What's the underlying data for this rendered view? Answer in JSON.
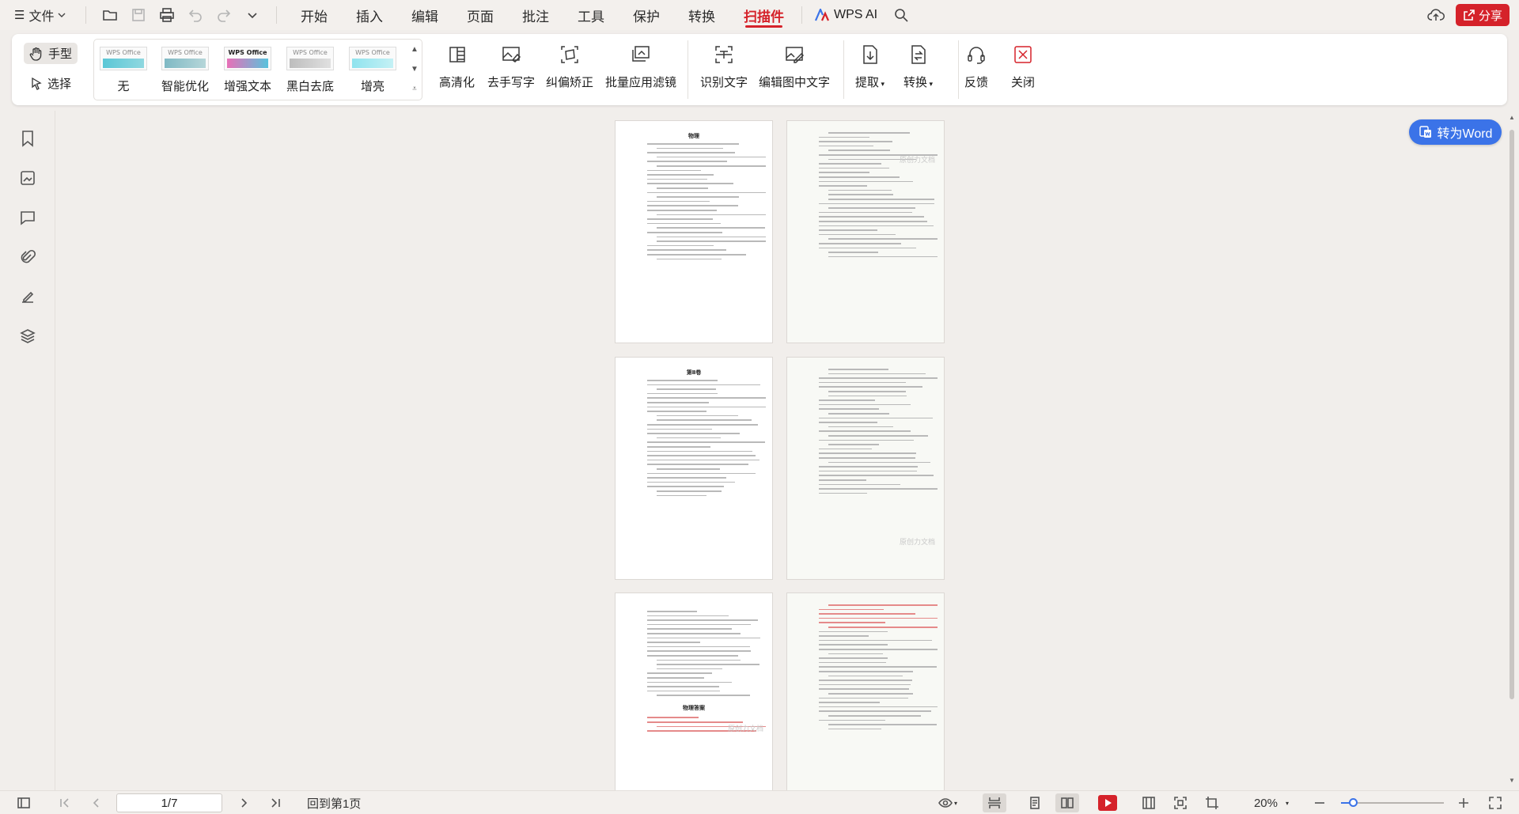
{
  "menubar": {
    "file_label": "文件",
    "tabs": [
      "开始",
      "插入",
      "编辑",
      "页面",
      "批注",
      "工具",
      "保护",
      "转换",
      "扫描件"
    ],
    "active_tab": "扫描件",
    "wps_ai": "WPS AI",
    "share": "分享"
  },
  "ribbon": {
    "hand": "手型",
    "select": "选择",
    "filters": [
      {
        "label": "无",
        "thumb": "WPS Office"
      },
      {
        "label": "智能优化",
        "thumb": "WPS Office"
      },
      {
        "label": "增强文本",
        "thumb": "WPS Office"
      },
      {
        "label": "黑白去底",
        "thumb": "WPS Office"
      },
      {
        "label": "增亮",
        "thumb": "WPS Office"
      }
    ],
    "buttons": {
      "hd": "高清化",
      "remove_handwriting": "去手写字",
      "deskew": "纠偏矫正",
      "batch_filter": "批量应用滤镜",
      "ocr": "识别文字",
      "edit_image_text": "编辑图中文字",
      "extract": "提取",
      "convert": "转换",
      "feedback": "反馈",
      "close": "关闭"
    }
  },
  "canvas": {
    "convert_to_word": "转为Word",
    "pages": [
      {
        "title": "物理",
        "accent": false
      },
      {
        "title": "",
        "accent": false
      },
      {
        "title": "第Ⅱ卷",
        "accent": false
      },
      {
        "title": "",
        "accent": false
      },
      {
        "title": "物理答案",
        "accent": true
      },
      {
        "title": "",
        "accent": true
      }
    ],
    "watermark": "原创力文档"
  },
  "statusbar": {
    "page_indicator": "1/7",
    "back_to_first": "回到第1页",
    "zoom": "20%",
    "zoom_fraction": 0.05
  },
  "colors": {
    "accent": "#d5222a",
    "primary": "#3b73e8",
    "background": "#f1eeeb"
  }
}
